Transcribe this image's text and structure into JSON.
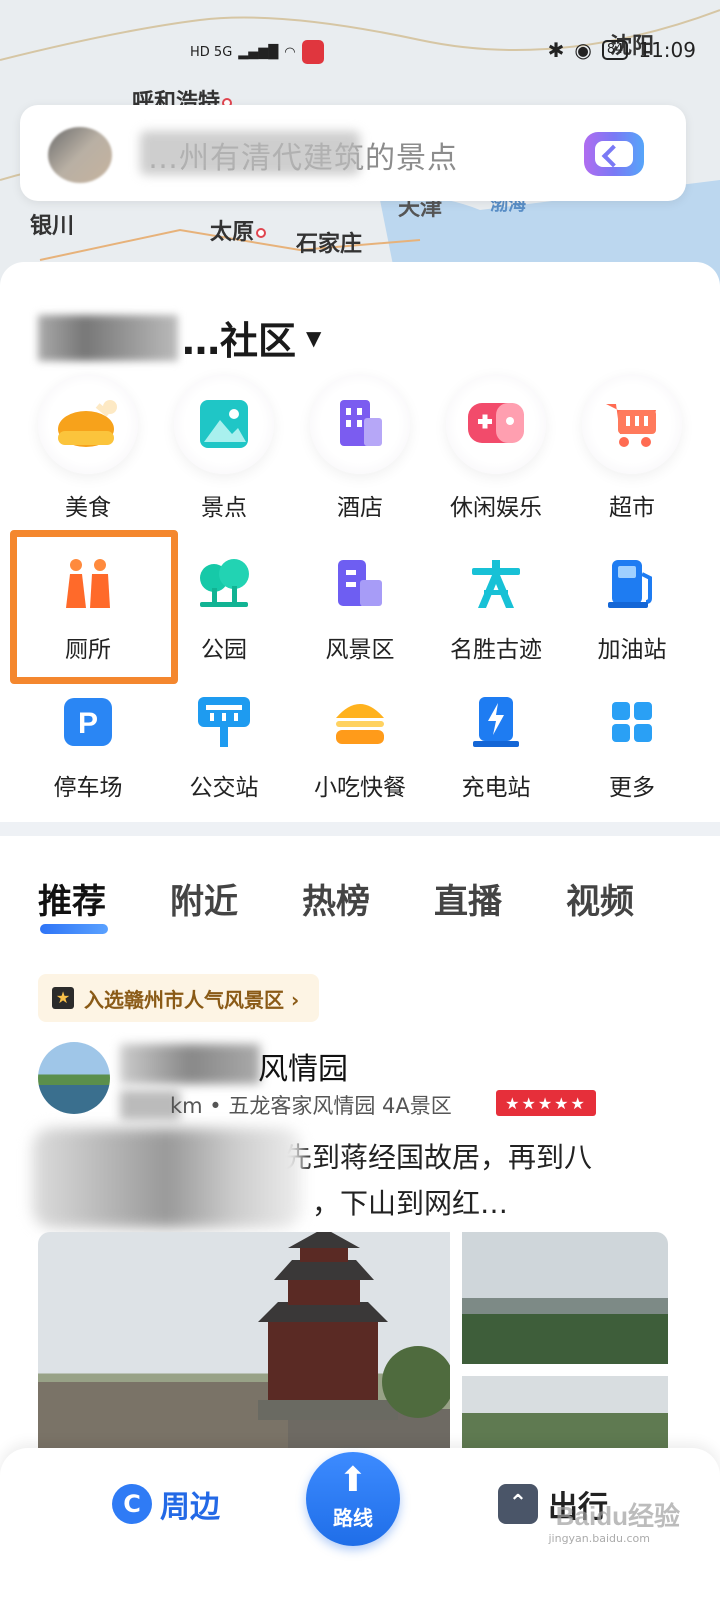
{
  "status_bar": {
    "network": "HD 5G",
    "battery": "84",
    "time": "11:09"
  },
  "map": {
    "cities": [
      "呼和浩特",
      "银川",
      "太原",
      "石家庄",
      "沈阳",
      "天津",
      "渤海"
    ]
  },
  "search": {
    "placeholder": "…州有清代建筑的景点"
  },
  "location": {
    "name": "…社区"
  },
  "categories": [
    {
      "label": "美食",
      "icon": "food-drumstick-icon"
    },
    {
      "label": "景点",
      "icon": "scenic-picture-icon"
    },
    {
      "label": "酒店",
      "icon": "hotel-building-icon"
    },
    {
      "label": "休闲娱乐",
      "icon": "gamepad-icon"
    },
    {
      "label": "超市",
      "icon": "shopping-cart-icon"
    },
    {
      "label": "厕所",
      "icon": "toilet-icon"
    },
    {
      "label": "公园",
      "icon": "park-tree-icon"
    },
    {
      "label": "风景区",
      "icon": "scenic-area-building-icon"
    },
    {
      "label": "名胜古迹",
      "icon": "historic-site-icon"
    },
    {
      "label": "加油站",
      "icon": "gas-station-icon"
    },
    {
      "label": "停车场",
      "icon": "parking-icon"
    },
    {
      "label": "公交站",
      "icon": "bus-stop-icon"
    },
    {
      "label": "小吃快餐",
      "icon": "burger-icon"
    },
    {
      "label": "充电站",
      "icon": "charging-station-icon"
    },
    {
      "label": "更多",
      "icon": "more-grid-icon"
    }
  ],
  "feed": {
    "tabs": [
      "推荐",
      "附近",
      "热榜",
      "直播",
      "视频"
    ],
    "active_tab": "推荐",
    "badge": "入选赣州市人气风景区 ›",
    "poi": {
      "title": "风情园",
      "meta": "km • 五龙客家风情园 4A景区",
      "rating": "★★★★★",
      "desc_line1": "理，先到蒋经国故居，再到八",
      "desc_line2": "，下山到网红…"
    }
  },
  "bottom_nav": {
    "near": "周边",
    "route": "路线",
    "trip": "出行"
  },
  "watermark": {
    "text": "Baidu经验",
    "sub": "jingyan.baidu.com"
  },
  "colors": {
    "accent": "#2f7bf5",
    "highlight": "#f4872e",
    "rating_red": "#e62f3a"
  }
}
